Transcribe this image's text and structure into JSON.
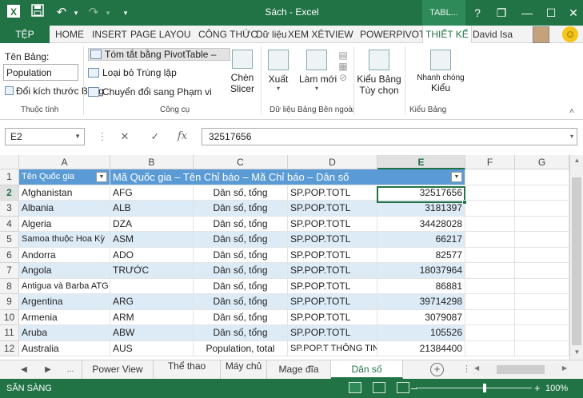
{
  "window": {
    "title": "Sách - Excel",
    "context_tab": "TABL...",
    "help": "?",
    "restore": "❐",
    "minimize": "—",
    "maximize": "☐",
    "close": "✕"
  },
  "quick_access": {
    "save_icon": "floppy-disk",
    "undo_icon": "undo-arrow",
    "redo_icon": "redo-arrow",
    "customize_icon": "dropdown-caret"
  },
  "ribbon_tabs": {
    "file": "TỆP",
    "home": "HOME",
    "insert": "INSERT",
    "page_layout": "PAGE LAYOU",
    "formulas": "CÔNG THỨC",
    "data": "Dữ liệu",
    "review": "XEM XÉT",
    "view": "VIEW",
    "powerpivot": "POWERPIVOT",
    "design": "THIẾT KẾ"
  },
  "user": {
    "name": "David Isa"
  },
  "ribbon": {
    "properties": {
      "table_name_label": "Tên Bảng:",
      "table_name_value": "Population",
      "resize_table": "Đổi kích thước Bảng",
      "group_label": "Thuộc tính"
    },
    "tools": {
      "summarize_pivot": "Tóm tắt bằng PivotTable –",
      "remove_duplicates": "Loại bỏ Trùng lặp",
      "convert_to_range": "Chuyển đổi sang Phạm vi",
      "slicer_line1": "Chèn",
      "slicer_line2": "Slicer",
      "group_label": "Công cụ"
    },
    "external_data": {
      "export": "Xuất",
      "refresh": "Làm mới",
      "group_label": "Dữ liệu Bảng Bên ngoài"
    },
    "table_style_options": {
      "line1": "Kiểu Bảng",
      "line2": "Tùy chọn"
    },
    "table_styles": {
      "quick_styles_line1": "Nhanh chóng",
      "quick_styles_line2": "Kiểu",
      "group_label": "Kiểu Bảng"
    }
  },
  "formula_bar": {
    "name_box": "E2",
    "cancel": "✕",
    "enter": "✓",
    "fx": "fx",
    "value": "32517656"
  },
  "columns": [
    "A",
    "B",
    "C",
    "D",
    "E",
    "F",
    "G"
  ],
  "header_row": {
    "row": "1",
    "col_a": "Tên Quốc gia",
    "merged": "Mã Quốc gia – Tên Chỉ báo – Mã Chỉ báo – Dân số"
  },
  "rows": [
    {
      "n": "2",
      "a": "Afghanistan",
      "b": "AFG",
      "c": "Dân số, tổng",
      "d": "SP.POP.TOTL",
      "e": "32517656"
    },
    {
      "n": "3",
      "a": "Albania",
      "b": "ALB",
      "c": "Dân số, tổng",
      "d": "SP.POP.TOTL",
      "e": "3181397"
    },
    {
      "n": "4",
      "a": "Algeria",
      "b": "DZA",
      "c": "Dân số, tổng",
      "d": "SP.POP.TOTL",
      "e": "34428028"
    },
    {
      "n": "5",
      "a": "Samoa thuộc Hoa Kỳ",
      "b": "ASM",
      "c": "Dân số, tổng",
      "d": "SP.POP.TOTL",
      "e": "66217"
    },
    {
      "n": "6",
      "a": "Andorra",
      "b": "ADO",
      "c": "Dân số, tổng",
      "d": "SP.POP.TOTL",
      "e": "82577"
    },
    {
      "n": "7",
      "a": "Angola",
      "b": "TRƯỚC",
      "c": "Dân số, tổng",
      "d": "SP.POP.TOTL",
      "e": "18037964"
    },
    {
      "n": "8",
      "a": "Antigua và Barba ATG",
      "b": "",
      "c": "Dân số, tổng",
      "d": "SP.POP.TOTL",
      "e": "86881"
    },
    {
      "n": "9",
      "a": "Argentina",
      "b": "ARG",
      "c": "Dân số, tổng",
      "d": "SP.POP.TOTL",
      "e": "39714298"
    },
    {
      "n": "10",
      "a": "Armenia",
      "b": "ARM",
      "c": "Dân số, tổng",
      "d": "SP.POP.TOTL",
      "e": "3079087"
    },
    {
      "n": "11",
      "a": "Aruba",
      "b": "ABW",
      "c": "Dân số, tổng",
      "d": "SP.POP.TOTL",
      "e": "105526"
    },
    {
      "n": "12",
      "a": "Australia",
      "b": "AUS",
      "c": "Population, total",
      "d": "SP.POP.T THÔNG TIN OTI",
      "e": "21384400"
    }
  ],
  "sheets": {
    "more": "...",
    "tabs": [
      "Power View",
      "Thể thao",
      "Máy chủ",
      "Mage đĩa",
      "Dân số"
    ],
    "active": "Dân số",
    "add": "+"
  },
  "status": {
    "text": "SẴN SÀNG",
    "zoom": "100%",
    "minus": "–",
    "plus": "+"
  }
}
